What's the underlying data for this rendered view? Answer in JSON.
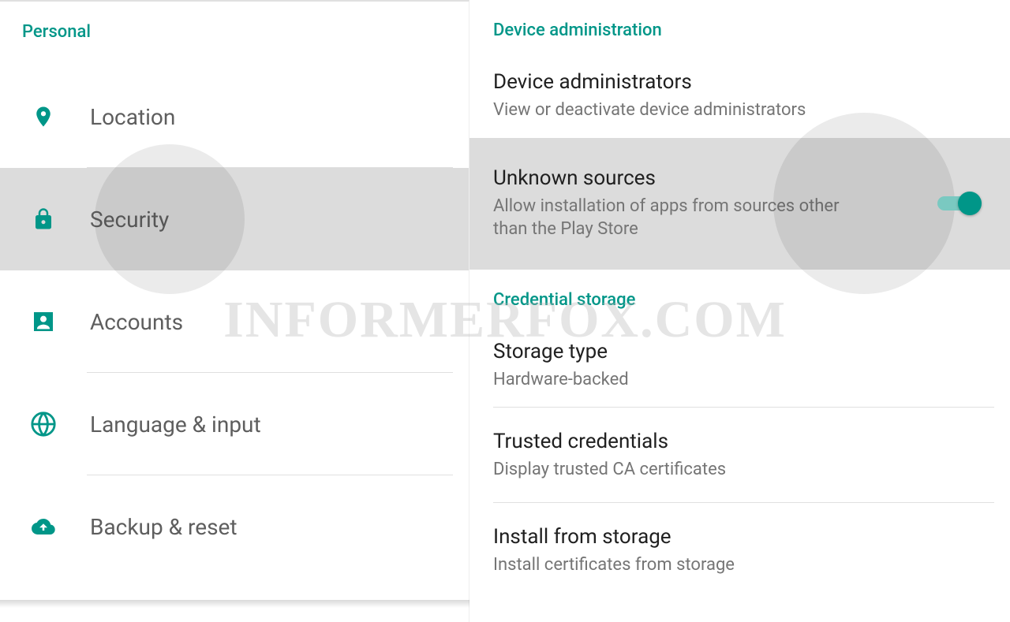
{
  "colors": {
    "accent": "#009688"
  },
  "watermark": "INFORMERFOX.COM",
  "left": {
    "header": "Personal",
    "items": [
      {
        "label": "Location",
        "icon": "location-icon",
        "selected": false
      },
      {
        "label": "Security",
        "icon": "lock-icon",
        "selected": true
      },
      {
        "label": "Accounts",
        "icon": "account-icon",
        "selected": false
      },
      {
        "label": "Language & input",
        "icon": "globe-icon",
        "selected": false
      },
      {
        "label": "Backup & reset",
        "icon": "backup-icon",
        "selected": false
      }
    ]
  },
  "right": {
    "sections": [
      {
        "header": "Device administration",
        "rows": [
          {
            "title": "Device administrators",
            "sub": "View or deactivate device administrators",
            "highlighted": false
          },
          {
            "title": "Unknown sources",
            "sub": "Allow installation of apps from sources other than the Play Store",
            "highlighted": true,
            "toggle": true,
            "toggle_on": true
          }
        ]
      },
      {
        "header": "Credential storage",
        "rows": [
          {
            "title": "Storage type",
            "sub": "Hardware-backed"
          },
          {
            "title": "Trusted credentials",
            "sub": "Display trusted CA certificates"
          },
          {
            "title": "Install from storage",
            "sub": "Install certificates from storage"
          }
        ]
      }
    ]
  }
}
